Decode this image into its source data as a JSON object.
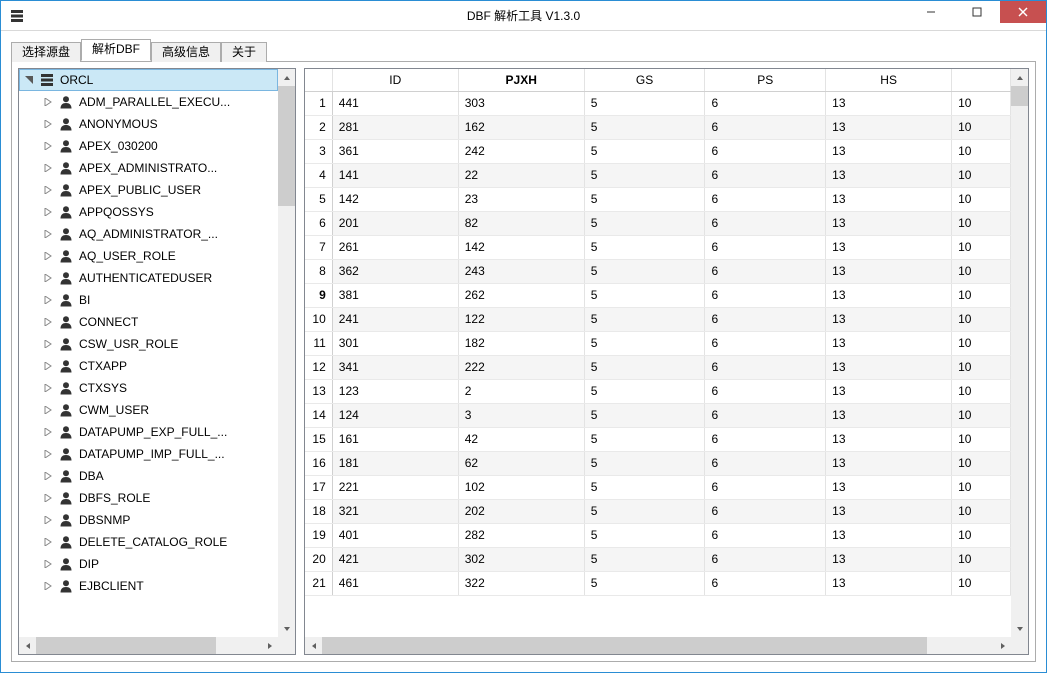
{
  "window": {
    "title": "DBF 解析工具  V1.3.0"
  },
  "tabs": [
    {
      "label": "选择源盘"
    },
    {
      "label": "解析DBF"
    },
    {
      "label": "高级信息"
    },
    {
      "label": "关于"
    }
  ],
  "active_tab_index": 1,
  "tree": {
    "root": {
      "label": "ORCL"
    },
    "items": [
      {
        "label": "ADM_PARALLEL_EXECU..."
      },
      {
        "label": "ANONYMOUS"
      },
      {
        "label": "APEX_030200"
      },
      {
        "label": "APEX_ADMINISTRATO..."
      },
      {
        "label": "APEX_PUBLIC_USER"
      },
      {
        "label": "APPQOSSYS"
      },
      {
        "label": "AQ_ADMINISTRATOR_..."
      },
      {
        "label": "AQ_USER_ROLE"
      },
      {
        "label": "AUTHENTICATEDUSER"
      },
      {
        "label": "BI"
      },
      {
        "label": "CONNECT"
      },
      {
        "label": "CSW_USR_ROLE"
      },
      {
        "label": "CTXAPP"
      },
      {
        "label": "CTXSYS"
      },
      {
        "label": "CWM_USER"
      },
      {
        "label": "DATAPUMP_EXP_FULL_..."
      },
      {
        "label": "DATAPUMP_IMP_FULL_..."
      },
      {
        "label": "DBA"
      },
      {
        "label": "DBFS_ROLE"
      },
      {
        "label": "DBSNMP"
      },
      {
        "label": "DELETE_CATALOG_ROLE"
      },
      {
        "label": "DIP"
      },
      {
        "label": "EJBCLIENT"
      }
    ]
  },
  "grid": {
    "columns": [
      {
        "label": "ID"
      },
      {
        "label": "PJXH",
        "sorted": true
      },
      {
        "label": "GS"
      },
      {
        "label": "PS"
      },
      {
        "label": "HS"
      },
      {
        "label": ""
      }
    ],
    "selected_row_index": 8,
    "rows": [
      {
        "n": "1",
        "ID": "441",
        "PJXH": "303",
        "GS": "5",
        "PS": "6",
        "HS": "13",
        "R": "10"
      },
      {
        "n": "2",
        "ID": "281",
        "PJXH": "162",
        "GS": "5",
        "PS": "6",
        "HS": "13",
        "R": "10"
      },
      {
        "n": "3",
        "ID": "361",
        "PJXH": "242",
        "GS": "5",
        "PS": "6",
        "HS": "13",
        "R": "10"
      },
      {
        "n": "4",
        "ID": "141",
        "PJXH": "22",
        "GS": "5",
        "PS": "6",
        "HS": "13",
        "R": "10"
      },
      {
        "n": "5",
        "ID": "142",
        "PJXH": "23",
        "GS": "5",
        "PS": "6",
        "HS": "13",
        "R": "10"
      },
      {
        "n": "6",
        "ID": "201",
        "PJXH": "82",
        "GS": "5",
        "PS": "6",
        "HS": "13",
        "R": "10"
      },
      {
        "n": "7",
        "ID": "261",
        "PJXH": "142",
        "GS": "5",
        "PS": "6",
        "HS": "13",
        "R": "10"
      },
      {
        "n": "8",
        "ID": "362",
        "PJXH": "243",
        "GS": "5",
        "PS": "6",
        "HS": "13",
        "R": "10"
      },
      {
        "n": "9",
        "ID": "381",
        "PJXH": "262",
        "GS": "5",
        "PS": "6",
        "HS": "13",
        "R": "10"
      },
      {
        "n": "10",
        "ID": "241",
        "PJXH": "122",
        "GS": "5",
        "PS": "6",
        "HS": "13",
        "R": "10"
      },
      {
        "n": "11",
        "ID": "301",
        "PJXH": "182",
        "GS": "5",
        "PS": "6",
        "HS": "13",
        "R": "10"
      },
      {
        "n": "12",
        "ID": "341",
        "PJXH": "222",
        "GS": "5",
        "PS": "6",
        "HS": "13",
        "R": "10"
      },
      {
        "n": "13",
        "ID": "123",
        "PJXH": "2",
        "GS": "5",
        "PS": "6",
        "HS": "13",
        "R": "10"
      },
      {
        "n": "14",
        "ID": "124",
        "PJXH": "3",
        "GS": "5",
        "PS": "6",
        "HS": "13",
        "R": "10"
      },
      {
        "n": "15",
        "ID": "161",
        "PJXH": "42",
        "GS": "5",
        "PS": "6",
        "HS": "13",
        "R": "10"
      },
      {
        "n": "16",
        "ID": "181",
        "PJXH": "62",
        "GS": "5",
        "PS": "6",
        "HS": "13",
        "R": "10"
      },
      {
        "n": "17",
        "ID": "221",
        "PJXH": "102",
        "GS": "5",
        "PS": "6",
        "HS": "13",
        "R": "10"
      },
      {
        "n": "18",
        "ID": "321",
        "PJXH": "202",
        "GS": "5",
        "PS": "6",
        "HS": "13",
        "R": "10"
      },
      {
        "n": "19",
        "ID": "401",
        "PJXH": "282",
        "GS": "5",
        "PS": "6",
        "HS": "13",
        "R": "10"
      },
      {
        "n": "20",
        "ID": "421",
        "PJXH": "302",
        "GS": "5",
        "PS": "6",
        "HS": "13",
        "R": "10"
      },
      {
        "n": "21",
        "ID": "461",
        "PJXH": "322",
        "GS": "5",
        "PS": "6",
        "HS": "13",
        "R": "10"
      }
    ]
  }
}
